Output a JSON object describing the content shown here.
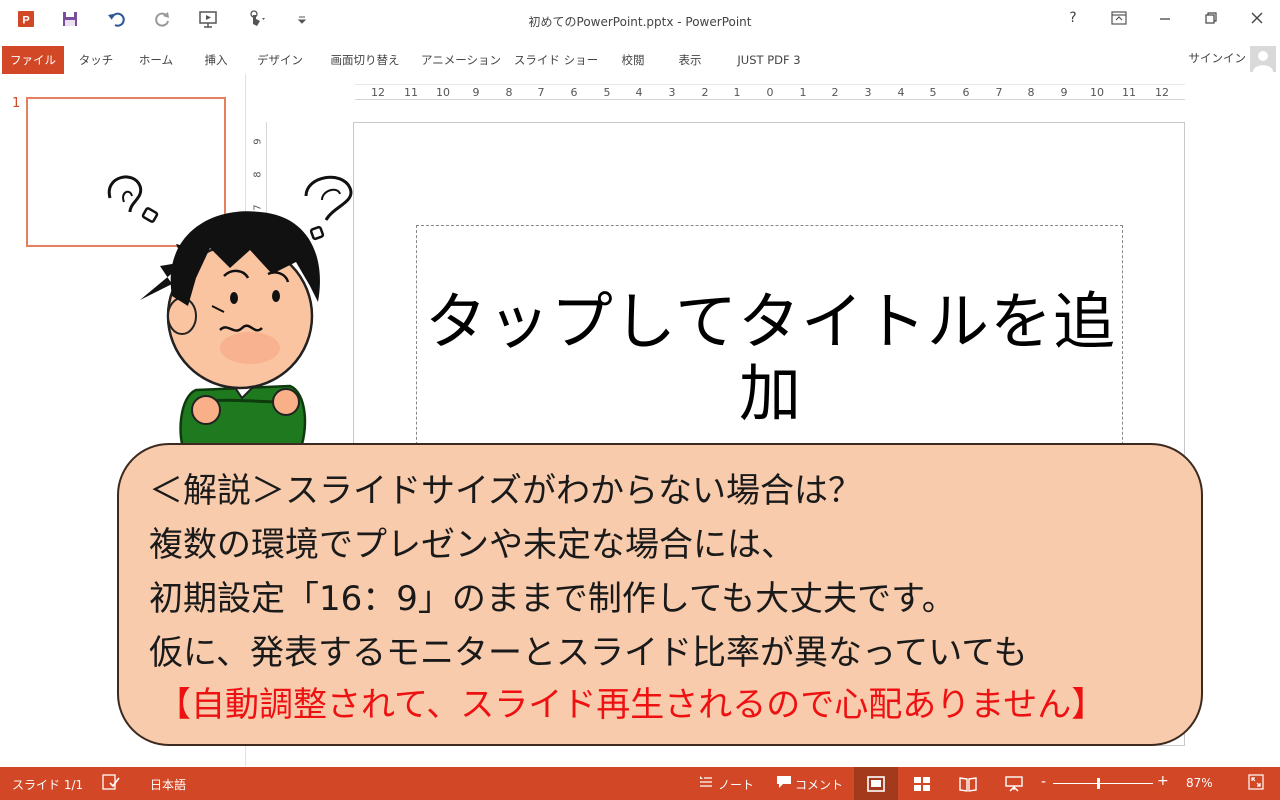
{
  "window": {
    "title": "初めてのPowerPoint.pptx - PowerPoint",
    "help_label": "?",
    "accent_color": "#d24726"
  },
  "quick_access": {
    "icons": [
      "powerpoint-logo-icon",
      "save-icon",
      "undo-icon",
      "redo-icon",
      "present-from-start-icon",
      "touch-mode-icon",
      "customize-toolbar-icon"
    ]
  },
  "ribbon": {
    "tabs": [
      {
        "label": "ファイル",
        "active": true
      },
      {
        "label": "タッチ"
      },
      {
        "label": "ホーム"
      },
      {
        "label": "挿入"
      },
      {
        "label": "デザイン"
      },
      {
        "label": "画面切り替え"
      },
      {
        "label": "アニメーション"
      },
      {
        "label": "スライド ショー"
      },
      {
        "label": "校閲"
      },
      {
        "label": "表示"
      },
      {
        "label": "JUST PDF 3"
      }
    ],
    "signin": "サインイン"
  },
  "thumbnails": {
    "slide_number": "1"
  },
  "ruler": {
    "horizontal_ticks": [
      "12",
      "11",
      "10",
      "9",
      "8",
      "7",
      "6",
      "5",
      "4",
      "3",
      "2",
      "1",
      "0",
      "1",
      "2",
      "3",
      "4",
      "5",
      "6",
      "7",
      "8",
      "9",
      "10",
      "11",
      "12"
    ],
    "vertical_ticks": [
      "9",
      "8",
      "7"
    ]
  },
  "slide": {
    "title_placeholder": "タップしてタイトルを追加"
  },
  "callout": {
    "lines": [
      "＜解説＞スライドサイズがわからない場合は？",
      "複数の環境でプレゼンや未定な場合には、",
      "初期設定「16：9」のままで制作しても大丈夫です。",
      "仮に、発表するモニターとスライド比率が異なっていても"
    ],
    "highlight": "【自動調整されて、スライド再生されるので心配ありません】",
    "highlight_color": "#ee1111",
    "fill_color": "#f8cbad"
  },
  "status": {
    "slide_indicator": "スライド 1/1",
    "language": "日本語",
    "notes": "ノート",
    "comments": "コメント",
    "zoom_minus": "-",
    "zoom_plus": "+",
    "zoom": "87%",
    "zoom_fraction": 0.45
  }
}
